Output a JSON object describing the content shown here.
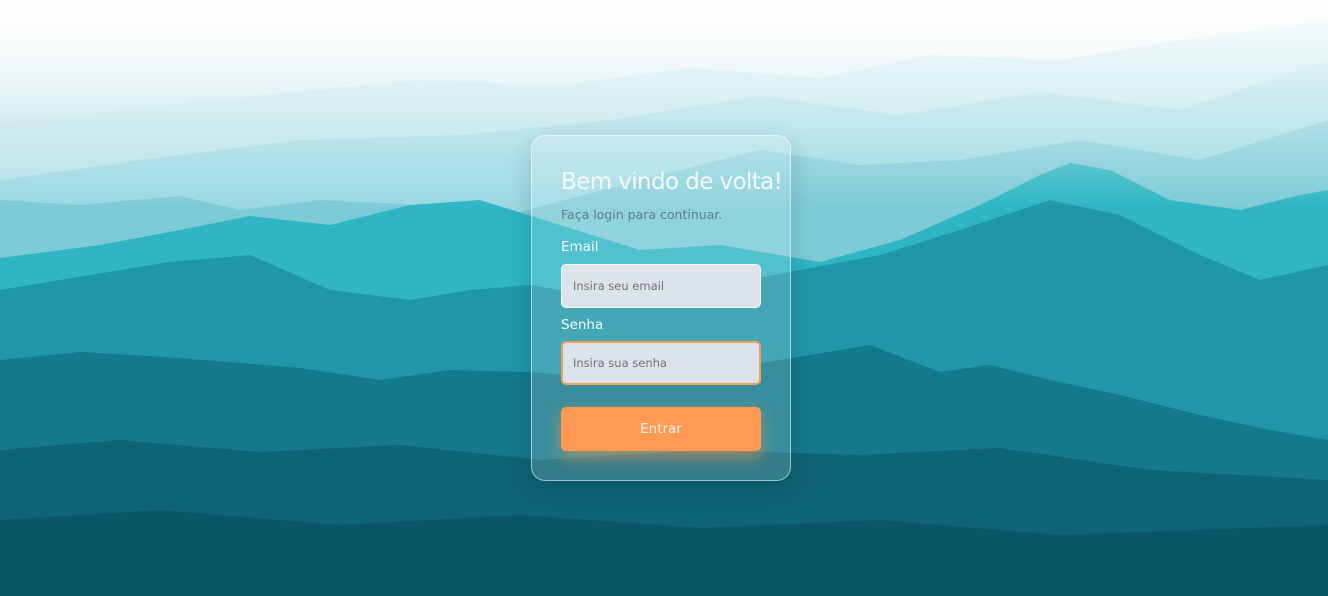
{
  "login": {
    "title": "Bem vindo de volta!",
    "subtitle": "Faça login para continuar.",
    "email_label": "Email",
    "email_placeholder": "Insira seu email",
    "password_label": "Senha",
    "password_placeholder": "Insira sua senha",
    "submit_label": "Entrar"
  },
  "colors": {
    "accent": "#ff9a55",
    "input_background": "#dde3ea",
    "focus_border": "#f59e5a"
  }
}
